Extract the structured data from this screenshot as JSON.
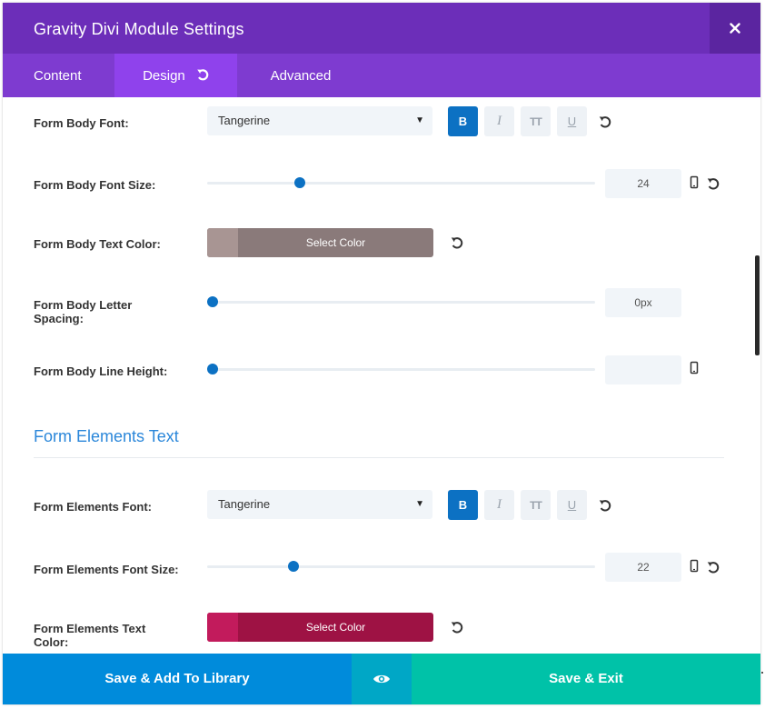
{
  "header": {
    "title": "Gravity Divi Module Settings",
    "close_icon": "close-icon"
  },
  "tabs": [
    {
      "label": "Content",
      "active": false
    },
    {
      "label": "Design",
      "active": true,
      "icon": "undo-icon"
    },
    {
      "label": "Advanced",
      "active": false
    }
  ],
  "form_body": {
    "font": {
      "label": "Form Body Font:",
      "value": "Tangerine"
    },
    "format_buttons": {
      "bold": "B",
      "italic": "I",
      "uppercase": "TT",
      "underline": "U",
      "bold_active": true
    },
    "font_size": {
      "label": "Form Body Font Size:",
      "value": "24",
      "level": 0.24
    },
    "text_color": {
      "label": "Form Body Text Color:",
      "button": "Select Color",
      "color": "#8a7a7a",
      "swatch": "#a89593"
    },
    "letter_spacing": {
      "label": "Form Body Letter Spacing:",
      "value": "0px",
      "level": 0.0
    },
    "line_height": {
      "label": "Form Body Line Height:",
      "value": "",
      "level": 0.0
    }
  },
  "form_elements": {
    "section_title": "Form Elements Text",
    "font": {
      "label": "Form Elements Font:",
      "value": "Tangerine"
    },
    "format_buttons": {
      "bold": "B",
      "italic": "I",
      "uppercase": "TT",
      "underline": "U",
      "bold_active": true
    },
    "font_size": {
      "label": "Form Elements Font Size:",
      "value": "22",
      "level": 0.22
    },
    "text_color": {
      "label": "Form Elements Text Color:",
      "button": "Select Color",
      "color": "#9e1244",
      "swatch": "#c21b5c"
    }
  },
  "footer": {
    "save_library": "Save & Add To Library",
    "preview_icon": "eye-icon",
    "save_exit": "Save & Exit"
  },
  "colors": {
    "header": "#6c2eb9",
    "tabs": "#7e3bd0",
    "tab_active": "#8f42ec",
    "accent_blue": "#0c71c3",
    "section_title": "#2b87da",
    "footer_library": "#008bdb",
    "footer_preview": "#00a7c6",
    "footer_save": "#00c2a8"
  }
}
